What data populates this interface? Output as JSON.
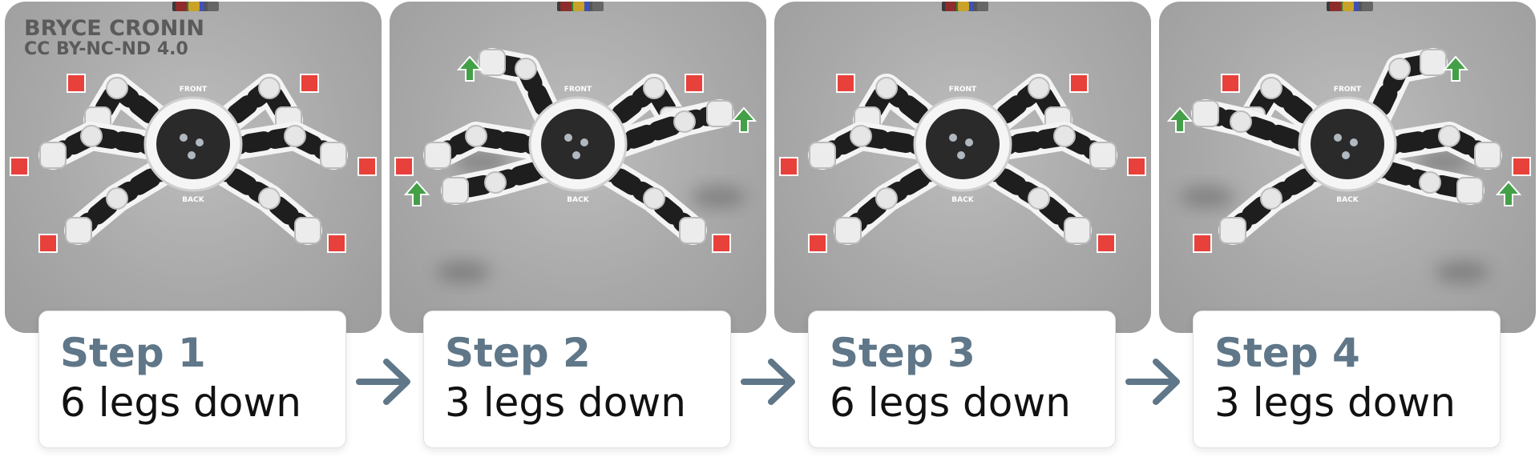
{
  "credit": {
    "author": "BRYCE CRONIN",
    "license": "CC BY-NC-ND 4.0"
  },
  "robot_labels": {
    "front": "FRONT",
    "back": "BACK"
  },
  "colors": {
    "panel_bg": "#a9a9a9",
    "foot_down": "#e8403a",
    "leg_lifted": "#43a047",
    "step_title": "#5f7788",
    "arrow": "#5f7788"
  },
  "steps": [
    {
      "title": "Step 1",
      "description": "6 legs down",
      "legs_down": 6,
      "lifted_legs": []
    },
    {
      "title": "Step 2",
      "description": "3 legs down",
      "legs_down": 3,
      "lifted_legs": [
        "front-left",
        "middle-right",
        "back-left"
      ]
    },
    {
      "title": "Step 3",
      "description": "6 legs down",
      "legs_down": 6,
      "lifted_legs": []
    },
    {
      "title": "Step 4",
      "description": "3 legs down",
      "legs_down": 3,
      "lifted_legs": [
        "front-right",
        "middle-left",
        "back-right"
      ]
    }
  ],
  "icons": {
    "foot_marker": "red-square-icon",
    "lift_marker": "green-up-arrow-icon",
    "step_separator": "right-arrow-icon"
  }
}
